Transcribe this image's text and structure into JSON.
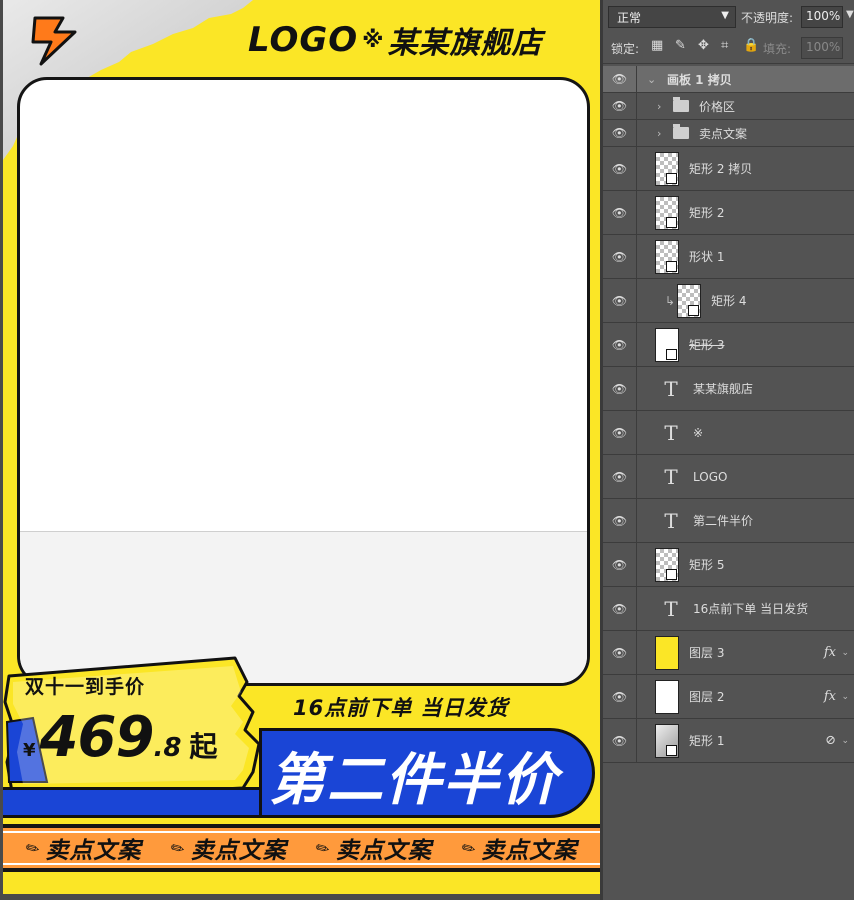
{
  "poster": {
    "logo": "LOGO",
    "mark": "※",
    "shop_name": "某某旗舰店",
    "price_label": "双十一到手价",
    "currency": "¥",
    "price_int": "469",
    "price_dec": ".8",
    "price_suffix": "起",
    "promo_line": "16点前下单 当日发货",
    "banner": "第二件半价",
    "selling_points": [
      "卖点文案",
      "卖点文案",
      "卖点文案",
      "卖点文案"
    ],
    "colors": {
      "background": "#fbe626",
      "banner": "#1a45d6",
      "strip": "#ff9a3c"
    }
  },
  "panel": {
    "blend_mode": "正常",
    "opacity_label": "不透明度:",
    "opacity_value": "100%",
    "lock_label": "锁定:",
    "fill_label": "填充:",
    "fill_value": "100%",
    "layers": [
      {
        "name": "画板 1 拷贝",
        "kind": "artboard"
      },
      {
        "name": "价格区",
        "kind": "group"
      },
      {
        "name": "卖点文案",
        "kind": "group"
      },
      {
        "name": "矩形 2 拷贝",
        "kind": "shape"
      },
      {
        "name": "矩形 2",
        "kind": "shape"
      },
      {
        "name": "形状 1",
        "kind": "shape"
      },
      {
        "name": "矩形 4",
        "kind": "shape-clipped"
      },
      {
        "name": "矩形 3",
        "kind": "shape-strike"
      },
      {
        "name": "某某旗舰店",
        "kind": "text"
      },
      {
        "name": "※",
        "kind": "text"
      },
      {
        "name": "LOGO",
        "kind": "text"
      },
      {
        "name": "第二件半价",
        "kind": "text"
      },
      {
        "name": "矩形 5",
        "kind": "shape"
      },
      {
        "name": "16点前下单 当日发货",
        "kind": "text"
      },
      {
        "name": "图层 3",
        "kind": "fill-yellow",
        "fx": "fx"
      },
      {
        "name": "图层 2",
        "kind": "fill-white",
        "fx": "fx"
      },
      {
        "name": "矩形 1",
        "kind": "shape-linked"
      }
    ]
  }
}
